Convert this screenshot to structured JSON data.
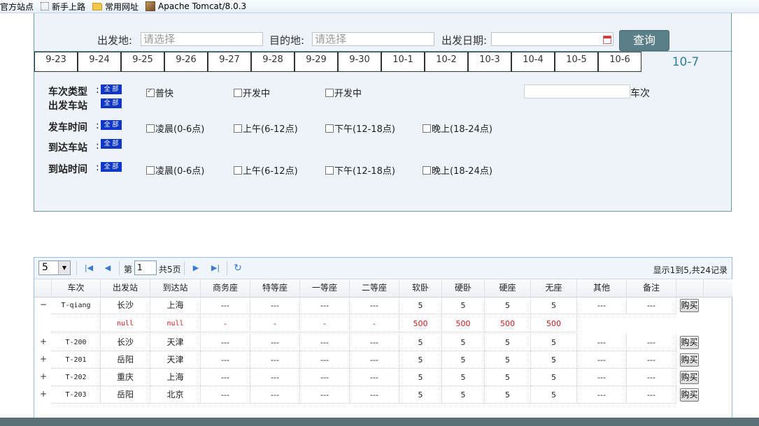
{
  "bookmarks": [
    "官方站点",
    "新手上路",
    "常用网址",
    "Apache Tomcat/8.0.3"
  ],
  "search": {
    "from_label": "出发地:",
    "from_placeholder": "请选择",
    "to_label": "目的地:",
    "to_placeholder": "请选择",
    "date_label": "出发日期:",
    "date_value": "",
    "query_button": "查询"
  },
  "dates": [
    "9-23",
    "9-24",
    "9-25",
    "9-26",
    "9-27",
    "9-28",
    "9-29",
    "9-30",
    "10-1",
    "10-2",
    "10-3",
    "10-4",
    "10-5",
    "10-6",
    "10-7"
  ],
  "selected_date": "10-7",
  "filters": {
    "all_label": "全 部",
    "train_type": {
      "label": "车次类型",
      "colon": ":",
      "options": [
        {
          "text": "普快",
          "checked": true
        },
        {
          "text": "开发中",
          "checked": false
        },
        {
          "text": "开发中",
          "checked": false
        }
      ]
    },
    "dep_station": {
      "label": "出发车站",
      "colon": ":"
    },
    "dep_time": {
      "label": "发车时间",
      "colon": ":",
      "options": [
        "凌晨(0-6点)",
        "上午(6-12点)",
        "下午(12-18点)",
        "晚上(18-24点)"
      ]
    },
    "arr_station": {
      "label": "到达车站",
      "colon": ":"
    },
    "arr_time": {
      "label": "到站时间",
      "colon": ":",
      "options": [
        "凌晨(0-6点)",
        "上午(6-12点)",
        "下午(12-18点)",
        "晚上(18-24点)"
      ]
    },
    "train_no_label": "车次"
  },
  "pager": {
    "page_size": "5",
    "page_prefix": "第",
    "page_value": "1",
    "total_pages": "共5页",
    "info": "显示1到5,共24记录"
  },
  "grid": {
    "columns": [
      "车次",
      "出发站",
      "到达站",
      "商务座",
      "特等座",
      "一等座",
      "二等座",
      "软卧",
      "硬卧",
      "硬座",
      "无座",
      "其他",
      "备注"
    ],
    "buy_label": "购买",
    "rows": [
      {
        "expanded": true,
        "cells": [
          "T-qiang",
          "长沙",
          "上海",
          "---",
          "---",
          "---",
          "---",
          "5",
          "5",
          "5",
          "5",
          "---",
          "---"
        ]
      },
      {
        "subrow": true,
        "cells": [
          "",
          "null",
          "null",
          "-",
          "-",
          "-",
          "-",
          "500",
          "500",
          "500",
          "500"
        ]
      },
      {
        "expanded": false,
        "cells": [
          "T-200",
          "长沙",
          "天津",
          "---",
          "---",
          "---",
          "---",
          "5",
          "5",
          "5",
          "5",
          "---",
          "---"
        ]
      },
      {
        "expanded": false,
        "cells": [
          "T-201",
          "岳阳",
          "天津",
          "---",
          "---",
          "---",
          "---",
          "5",
          "5",
          "5",
          "5",
          "---",
          "---"
        ]
      },
      {
        "expanded": false,
        "cells": [
          "T-202",
          "重庆",
          "上海",
          "---",
          "---",
          "---",
          "---",
          "5",
          "5",
          "5",
          "5",
          "---",
          "---"
        ]
      },
      {
        "expanded": false,
        "cells": [
          "T-203",
          "岳阳",
          "北京",
          "---",
          "---",
          "---",
          "---",
          "5",
          "5",
          "5",
          "5",
          "---",
          "---"
        ]
      }
    ]
  }
}
